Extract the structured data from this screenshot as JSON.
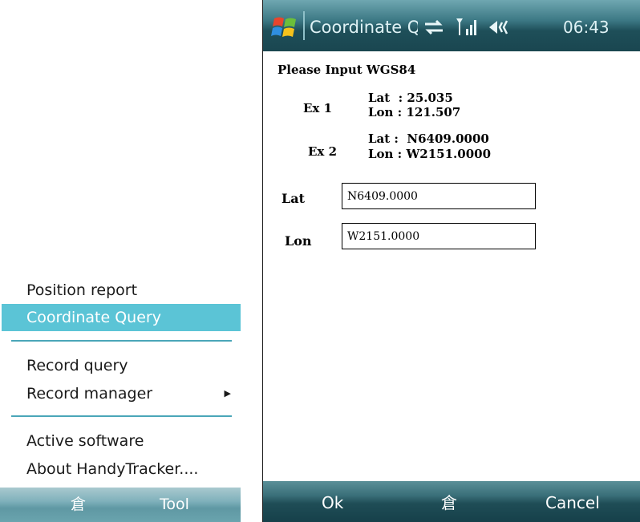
{
  "left_menu": {
    "items": [
      {
        "label": "Position report"
      },
      {
        "label": "Coordinate Query",
        "selected": true
      },
      {
        "label": "Record query"
      },
      {
        "label": "Record manager",
        "submenu_arrow": "▶"
      },
      {
        "label": "Active software"
      },
      {
        "label": "About HandyTracker...."
      }
    ]
  },
  "left_softbar": {
    "keyboard_icon": "倉",
    "right_label": "Tool"
  },
  "title_bar": {
    "title": "Coordinate Query",
    "icons": [
      "start-flag-icon",
      "connectivity-icon",
      "signal-icon",
      "volume-icon"
    ],
    "time": "06:43"
  },
  "form": {
    "prompt": "Please Input WGS84",
    "examples": [
      {
        "label": "Ex 1",
        "lat": "Lat  : 25.035",
        "lon": "Lon : 121.507"
      },
      {
        "label": "Ex 2",
        "lat": "Lat :  N6409.0000",
        "lon": "Lon : W2151.0000"
      }
    ],
    "lat_label": "Lat",
    "lat_value": "N6409.0000",
    "lon_label": "Lon",
    "lon_value": "W2151.0000"
  },
  "right_softbar": {
    "left_label": "Ok",
    "keyboard_icon": "倉",
    "right_label": "Cancel"
  },
  "colors": {
    "selection": "#5bc4d6",
    "separator": "#4aa6b8",
    "titlebar": "#1e4f59"
  }
}
